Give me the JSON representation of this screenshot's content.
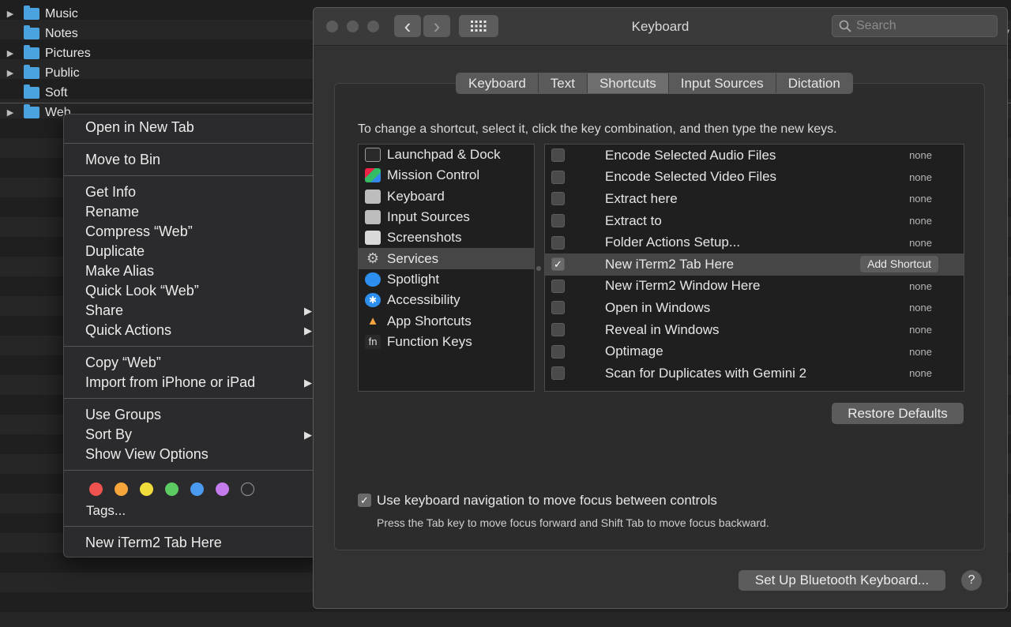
{
  "finder": {
    "rows": [
      {
        "name": "Music",
        "expandable": true
      },
      {
        "name": "Notes",
        "expandable": false
      },
      {
        "name": "Pictures",
        "expandable": true
      },
      {
        "name": "Public",
        "expandable": true
      },
      {
        "name": "Soft",
        "expandable": false
      },
      {
        "name": "Web",
        "expandable": true
      }
    ],
    "edge_text": "y"
  },
  "context_menu": {
    "open_new_tab": "Open in New Tab",
    "move_to_bin": "Move to Bin",
    "get_info": "Get Info",
    "rename": "Rename",
    "compress": "Compress “Web”",
    "duplicate": "Duplicate",
    "make_alias": "Make Alias",
    "quick_look": "Quick Look “Web”",
    "share": "Share",
    "quick_actions": "Quick Actions",
    "copy": "Copy “Web”",
    "import_iphone": "Import from iPhone or iPad",
    "use_groups": "Use Groups",
    "sort_by": "Sort By",
    "show_view_options": "Show View Options",
    "tag_colors": [
      "#ef5350",
      "#f5a53a",
      "#f2dc3c",
      "#5ccc62",
      "#4a9bef",
      "#c47bec"
    ],
    "tags": "Tags...",
    "new_iterm_tab": "New iTerm2 Tab Here",
    "submenu_arrow": "▶"
  },
  "window": {
    "title": "Keyboard",
    "search_placeholder": "Search",
    "back_glyph": "‹",
    "forward_glyph": "›",
    "tabs": [
      "Keyboard",
      "Text",
      "Shortcuts",
      "Input Sources",
      "Dictation"
    ],
    "active_tab": "Shortcuts",
    "instructions": "To change a shortcut, select it, click the key combination, and then type the new keys.",
    "categories": [
      {
        "label": "Launchpad & Dock",
        "icon": "launchpad-dock-icon"
      },
      {
        "label": "Mission Control",
        "icon": "mission-control-icon"
      },
      {
        "label": "Keyboard",
        "icon": "keyboard-icon"
      },
      {
        "label": "Input Sources",
        "icon": "input-sources-icon"
      },
      {
        "label": "Screenshots",
        "icon": "screenshots-icon"
      },
      {
        "label": "Services",
        "icon": "gear-icon"
      },
      {
        "label": "Spotlight",
        "icon": "spotlight-icon"
      },
      {
        "label": "Accessibility",
        "icon": "accessibility-icon"
      },
      {
        "label": "App Shortcuts",
        "icon": "app-shortcuts-icon"
      },
      {
        "label": "Function Keys",
        "icon": "function-keys-icon"
      }
    ],
    "fn_label": "fn",
    "selected_category": "Services",
    "shortcuts": [
      {
        "name": "Encode Selected Audio Files",
        "checked": false,
        "key": "none"
      },
      {
        "name": "Encode Selected Video Files",
        "checked": false,
        "key": "none"
      },
      {
        "name": "Extract here",
        "checked": false,
        "key": "none"
      },
      {
        "name": "Extract to",
        "checked": false,
        "key": "none"
      },
      {
        "name": "Folder Actions Setup...",
        "checked": false,
        "key": "none"
      },
      {
        "name": "New iTerm2 Tab Here",
        "checked": true,
        "key": "Add Shortcut",
        "selected": true
      },
      {
        "name": "New iTerm2 Window Here",
        "checked": false,
        "key": "none"
      },
      {
        "name": "Open in Windows",
        "checked": false,
        "key": "none"
      },
      {
        "name": "Reveal in Windows",
        "checked": false,
        "key": "none"
      },
      {
        "name": "Optimage",
        "checked": false,
        "key": "none"
      },
      {
        "name": "Scan for Duplicates with Gemini 2",
        "checked": false,
        "key": "none"
      }
    ],
    "restore_defaults": "Restore Defaults",
    "keyboard_nav_label": "Use keyboard navigation to move focus between controls",
    "keyboard_nav_checked": true,
    "keyboard_nav_hint": "Press the Tab key to move focus forward and Shift Tab to move focus backward.",
    "bluetooth_button": "Set Up Bluetooth Keyboard...",
    "help_glyph": "?"
  }
}
